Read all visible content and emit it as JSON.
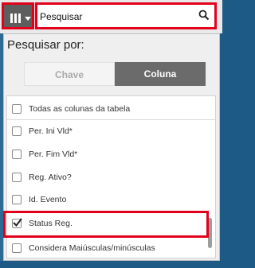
{
  "toolbar": {
    "columns_icon": "column-chooser-icon",
    "caret_icon": "chevron-down-icon"
  },
  "search": {
    "value": "Pesquisar",
    "icon": "search-icon"
  },
  "panel": {
    "label": "Pesquisar por:",
    "segments": [
      {
        "label": "Chave",
        "active": false
      },
      {
        "label": "Coluna",
        "active": true
      }
    ]
  },
  "list": {
    "select_all": {
      "label": "Todas as colunas da tabela",
      "checked": false
    },
    "items": [
      {
        "label": "Per. Ini Vld*",
        "checked": false
      },
      {
        "label": "Per. Fim Vld*",
        "checked": false
      },
      {
        "label": "Reg. Ativo?",
        "checked": false
      },
      {
        "label": "Id. Evento",
        "checked": false
      },
      {
        "label": "Status Reg.",
        "checked": true
      }
    ],
    "case_option": {
      "label": "Considera Maiúsculas/minúsculas",
      "checked": false
    }
  },
  "colors": {
    "highlight": "#e2001a",
    "active_segment": "#6b6b6b",
    "background": "#1e5a86"
  }
}
